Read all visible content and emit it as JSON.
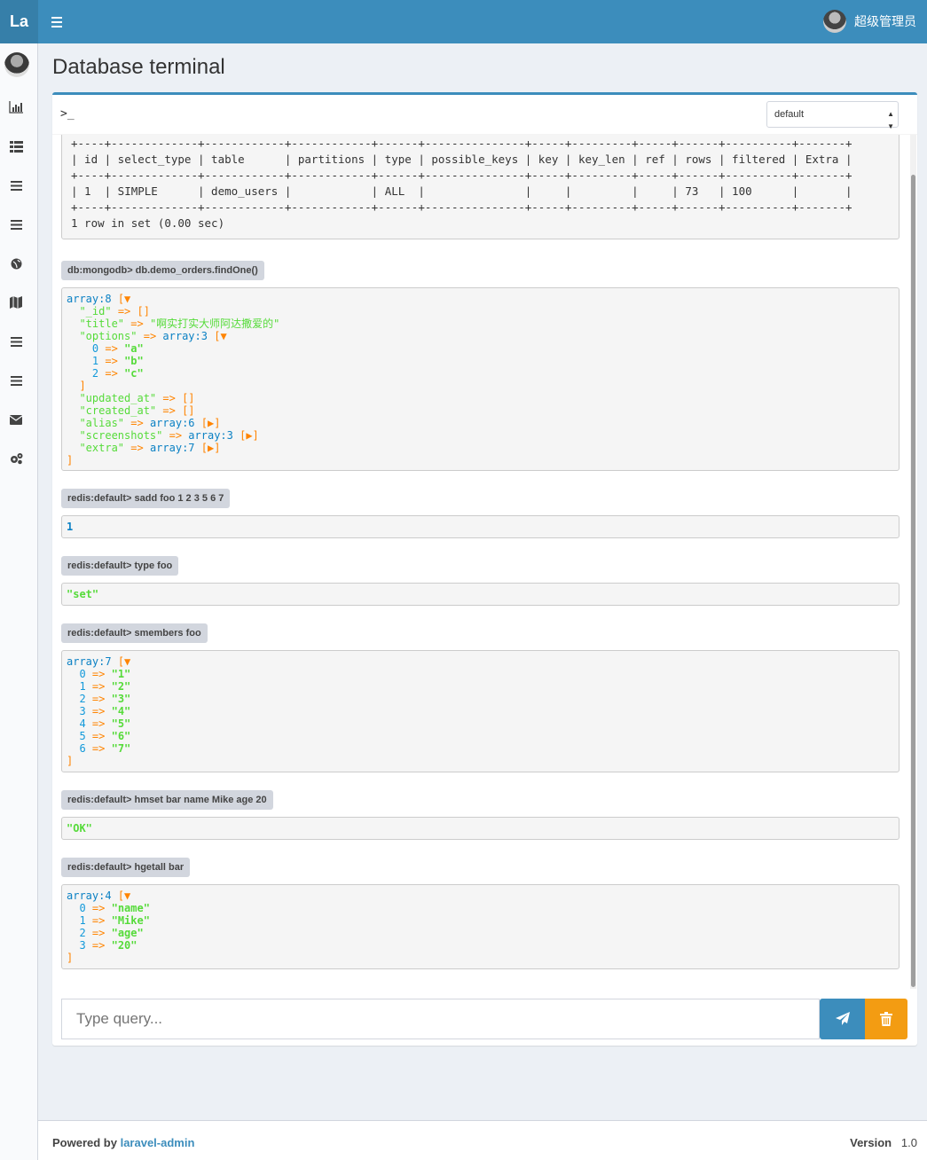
{
  "header": {
    "logo": "La",
    "user_name": "超级管理员"
  },
  "sidebar": {
    "icons": [
      "bar-chart-icon",
      "table-icon",
      "bars-icon",
      "bars-icon",
      "globe-icon",
      "map-icon",
      "bars-icon",
      "bars-icon",
      "envelope-icon",
      "gears-icon"
    ]
  },
  "page": {
    "title": "Database terminal"
  },
  "terminal": {
    "prompt": ">_",
    "connection": "default",
    "query_placeholder": "Type query...",
    "sql_result": {
      "separator": "+----+-------------+------------+------------+------+---------------+-----+---------+-----+------+----------+-------+",
      "header_row": "| id | select_type | table      | partitions | type | possible_keys | key | key_len | ref | rows | filtered | Extra |",
      "data_row": "| 1  | SIMPLE      | demo_users |            | ALL  |               |     |         |     | 73   | 100      |       |",
      "summary": "1 row in set (0.00 sec)"
    },
    "commands": [
      "db:mongodb> db.demo_orders.findOne()",
      "redis:default> sadd foo 1 2 3 5 6 7",
      "redis:default> type foo",
      "redis:default> smembers foo",
      "redis:default> hmset bar name Mike age 20",
      "redis:default> hgetall bar"
    ],
    "mongo_result": {
      "header": "array:8",
      "id_key": "\"_id\"",
      "title_key": "\"title\"",
      "title_value": "\"啊实打实大师阿达撒爱的\"",
      "options_key": "\"options\"",
      "options_header": "array:3",
      "options": [
        "\"a\"",
        "\"b\"",
        "\"c\""
      ],
      "updated_key": "\"updated_at\"",
      "created_key": "\"created_at\"",
      "alias_key": "\"alias\"",
      "alias_value": "array:6",
      "screenshots_key": "\"screenshots\"",
      "screenshots_value": "array:3",
      "extra_key": "\"extra\"",
      "extra_value": "array:7"
    },
    "sadd_result": "1",
    "type_result": "\"set\"",
    "smembers_result": {
      "header": "array:7",
      "values": [
        "\"1\"",
        "\"2\"",
        "\"3\"",
        "\"4\"",
        "\"5\"",
        "\"6\"",
        "\"7\""
      ]
    },
    "hmset_result": "\"OK\"",
    "hgetall_result": {
      "header": "array:4",
      "values": [
        "\"name\"",
        "\"Mike\"",
        "\"age\"",
        "\"20\""
      ]
    }
  },
  "footer": {
    "powered_by": "Powered by",
    "link": "laravel-admin",
    "version_label": "Version",
    "version": "1.0"
  }
}
